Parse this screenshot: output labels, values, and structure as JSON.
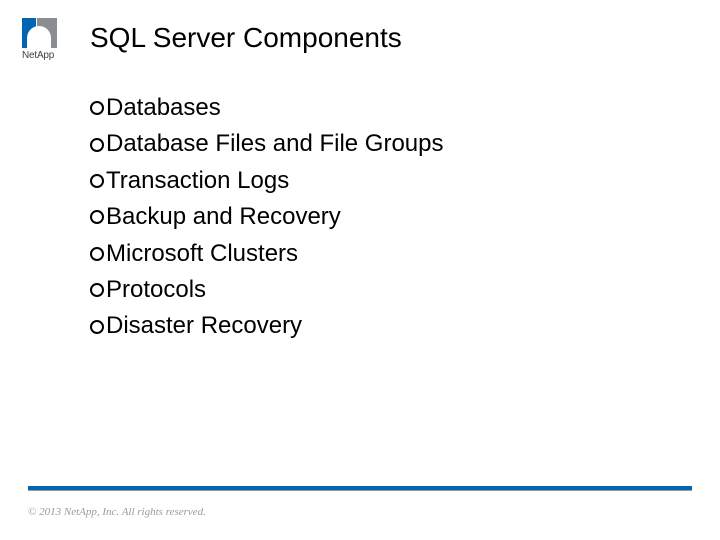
{
  "logo": {
    "text": "NetApp"
  },
  "title": "SQL Server Components",
  "bullets": [
    "Databases",
    "Database Files and File Groups",
    "Transaction Logs",
    "Backup and Recovery",
    "Microsoft Clusters",
    "Protocols",
    "Disaster Recovery"
  ],
  "copyright": "© 2013 NetApp, Inc. All rights reserved."
}
